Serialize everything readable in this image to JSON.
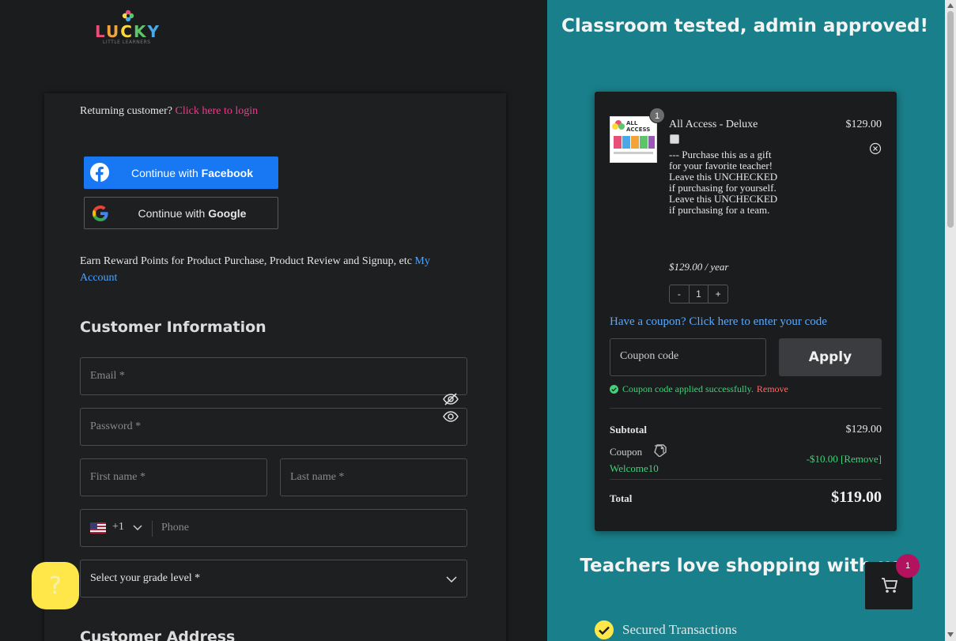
{
  "logo": {
    "text": "LUCKY",
    "subtitle": "LITTLE LEARNERS"
  },
  "returning": {
    "prefix": "Returning customer? ",
    "link": "Click here to login"
  },
  "social": {
    "facebook_prefix": "Continue with ",
    "facebook_brand": "Facebook",
    "google_prefix": "Continue with ",
    "google_brand": "Google"
  },
  "reward": {
    "text": "Earn Reward Points for Product Purchase, Product Review and Signup, etc ",
    "link": "My Account"
  },
  "customer_info": {
    "heading": "Customer Information",
    "email_placeholder": "Email *",
    "password_placeholder": "Password *",
    "firstname_placeholder": "First name *",
    "lastname_placeholder": "Last name *",
    "phone_dial_code": "+1",
    "phone_placeholder": "Phone",
    "grade_placeholder": "Select your grade level *"
  },
  "customer_address": {
    "heading": "Customer Address"
  },
  "help": {
    "label": "?"
  },
  "right": {
    "tagline": "Classroom tested, admin approved!",
    "teachers_love": "Teachers love shopping with us!",
    "secured": "Secured Transactions"
  },
  "cart": {
    "item": {
      "quantity_badge": "1",
      "name": "All Access - Deluxe",
      "price": "$129.00",
      "gift_text": "--- Purchase this as a gift for your favorite teacher! Leave this UNCHECKED if purchasing for yourself. Leave this UNCHECKED if purchasing for a team.",
      "subscription": "$129.00 / year",
      "qty_minus": "-",
      "qty": "1",
      "qty_plus": "+",
      "thumb_text": "ALL ACCESS"
    },
    "coupon_link": "Have a coupon? Click here to enter your code",
    "coupon_placeholder": "Coupon code",
    "apply_label": "Apply",
    "coupon_success": "Coupon code applied successfully.",
    "coupon_remove": "Remove",
    "subtotal_label": "Subtotal",
    "subtotal_value": "$129.00",
    "coupon_label": "Coupon",
    "coupon_code": "Welcome10",
    "coupon_discount": "-$10.00 [Remove]",
    "total_label": "Total",
    "total_value": "$119.00",
    "float_badge": "1"
  },
  "colors": {
    "accent_teal": "#197f8a",
    "facebook_blue": "#1877f2",
    "link_pink": "#e83e8c",
    "link_blue": "#4ea3ff",
    "success_green": "#3fd27a",
    "badge_magenta": "#b3125f",
    "help_yellow": "#ffe74a"
  },
  "icons": {
    "facebook": "facebook-icon",
    "google": "google-icon",
    "eye_slash": "eye-slash-icon",
    "eye": "eye-icon",
    "flag": "us-flag-icon",
    "chevron": "chevron-down-icon",
    "remove": "close-circle-icon",
    "tag": "tag-icon",
    "check": "check-circle-icon",
    "cart": "cart-icon"
  }
}
